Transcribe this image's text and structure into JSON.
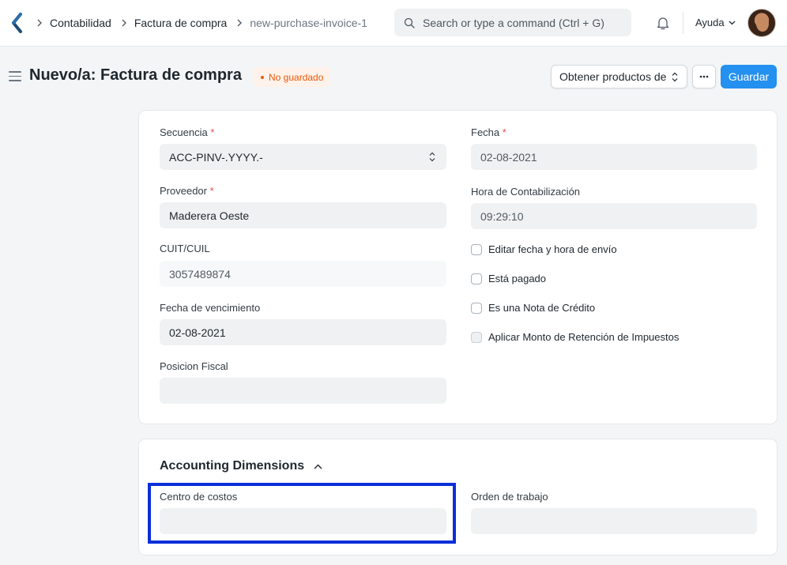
{
  "navbar": {
    "breadcrumbs": [
      "Contabilidad",
      "Factura de compra",
      "new-purchase-invoice-1"
    ],
    "search_placeholder": "Search or type a command (Ctrl + G)",
    "help_label": "Ayuda"
  },
  "page": {
    "title": "Nuevo/a: Factura de compra",
    "status": "No guardado",
    "get_items_label": "Obtener productos de",
    "more_label": "···",
    "save_label": "Guardar"
  },
  "form": {
    "naming_series": {
      "label": "Secuencia",
      "value": "ACC-PINV-.YYYY.-"
    },
    "supplier": {
      "label": "Proveedor",
      "value": "Maderera Oeste"
    },
    "tax_id": {
      "label": "CUIT/CUIL",
      "value": "3057489874"
    },
    "due_date": {
      "label": "Fecha de vencimiento",
      "value": "02-08-2021"
    },
    "tax_category": {
      "label": "Posicion Fiscal",
      "value": ""
    },
    "posting_date": {
      "label": "Fecha",
      "value": "02-08-2021"
    },
    "posting_time": {
      "label": "Hora de Contabilización",
      "value": "09:29:10"
    },
    "checkboxes": {
      "edit_posting": "Editar fecha y hora de envío",
      "is_paid": "Está pagado",
      "is_return": "Es una Nota de Crédito",
      "apply_tds": "Aplicar Monto de Retención de Impuestos"
    }
  },
  "dimensions": {
    "title": "Accounting Dimensions",
    "cost_center": {
      "label": "Centro de costos",
      "value": ""
    },
    "work_order": {
      "label": "Orden de trabajo",
      "value": ""
    }
  },
  "colors": {
    "primary": "#2490ef",
    "warning": "#e8590c",
    "highlight": "#0a2fd9"
  }
}
